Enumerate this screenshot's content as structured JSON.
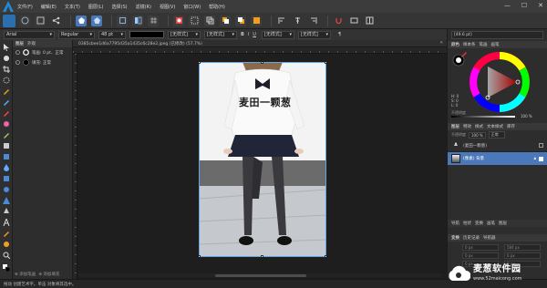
{
  "menu": {
    "items": [
      "文件(F)",
      "编辑(E)",
      "文本(T)",
      "图层(L)",
      "选择(S)",
      "滤镜(R)",
      "视图(V)",
      "窗口(W)",
      "帮助(H)"
    ]
  },
  "window_controls": {
    "minimize": "—",
    "maximize": "☐",
    "close": "✕"
  },
  "context_bar": {
    "font": "Arial",
    "style": "Regular",
    "size": "48 pt",
    "para1": "[无样式]",
    "para2": "[无样式]",
    "char1": "[无样式]",
    "char2": "[无样式]",
    "char_style": "[49.6 pt]",
    "pilcrow": "¶"
  },
  "layer_panel": {
    "tabs": [
      "图层",
      "外观"
    ],
    "rows": [
      {
        "label": "笔画: 0 pt、正常"
      },
      {
        "label": "填充: 正常"
      }
    ],
    "bottom_actions": [
      "添加笔画",
      "添加填充"
    ]
  },
  "document": {
    "tab_title": "0385cbee1d6a7795d35a1435c6c28e2.jpeg (已修改) (57.7%)",
    "close": "✕",
    "overlay_text": "麦田一颗葱"
  },
  "right_panel": {
    "field_top": "[49.6 pt]",
    "color_tabs": [
      "颜色",
      "样本条",
      "笔画",
      "画笔"
    ],
    "hsl": {
      "h": "H: 0",
      "s": "S: 0",
      "l": "L: 0"
    },
    "opacity_label": "不透明度",
    "opacity_value": "100 %",
    "layers_tabs": [
      "图层",
      "特效",
      "样式",
      "文本样式",
      "库存"
    ],
    "blend_label": "不透明度",
    "blend_value": "100 %",
    "blend_mode": "正常",
    "layer_rows": [
      {
        "name": "(麦田一颗葱)"
      },
      {
        "name": "(像素) 背景"
      }
    ],
    "mid_tabs": [
      "导航",
      "柱状",
      "变换",
      "画笔",
      "图层"
    ],
    "transform_tabs": [
      "变换",
      "历史记录",
      "导航器"
    ],
    "transform_values": [
      "0 px",
      "584 px",
      "0 px",
      "0 px",
      "0 px",
      "0 px"
    ]
  },
  "status": {
    "text": "拖动 创建艺术字。单击 对象将其选中。"
  },
  "brand": {
    "name": "麦葱软件园",
    "url": "www.52maicong.com"
  },
  "colors": {
    "accent": "#1f8ad6",
    "selection": "#5ea6e8",
    "layer_highlight": "#4a78b8"
  }
}
